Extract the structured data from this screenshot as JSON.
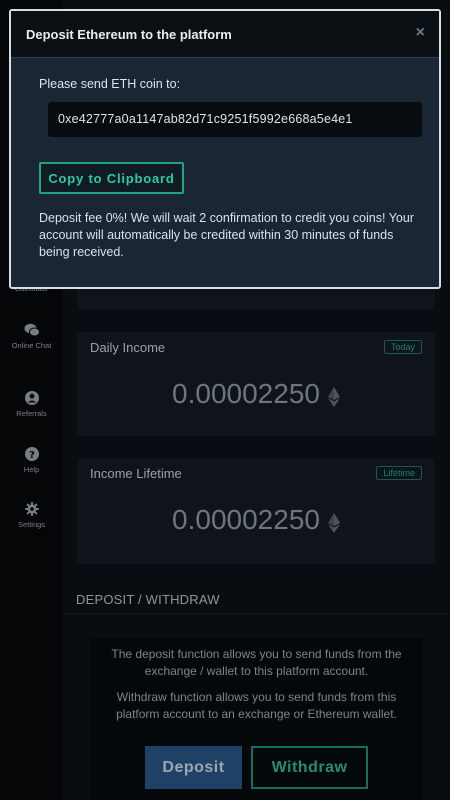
{
  "modal": {
    "title": "Deposit Ethereum to the platform",
    "close_symbol": "×",
    "send_label": "Please send ETH coin to:",
    "address": "0xe42777a0a1147ab82d71c9251f5992e668a5e4e1",
    "copy_button": "Copy to Clipboard",
    "fee_note": "Deposit fee 0%! We will wait 2 confirmation to credit you coins! Your account will automatically be credited within 30 minutes of funds being received."
  },
  "sidebar": {
    "items": [
      {
        "label": "Calculator",
        "icon": "calculator-icon"
      },
      {
        "label": "Online Chat",
        "icon": "chat-icon"
      },
      {
        "label": "Referrals",
        "icon": "user-icon"
      },
      {
        "label": "Help",
        "icon": "question-icon"
      },
      {
        "label": "Settings",
        "icon": "gear-icon"
      }
    ]
  },
  "cards": {
    "daily": {
      "title": "Daily Income",
      "badge": "Today",
      "value": "0.00002250"
    },
    "lifetime": {
      "title": "Income Lifetime",
      "badge": "Lifetime",
      "value": "0.00002250"
    }
  },
  "deposit_withdraw": {
    "heading": "DEPOSIT / WITHDRAW",
    "deposit_text": "The deposit function allows you to send funds from the exchange / wallet to this platform account.",
    "withdraw_text": "Withdraw function allows you to send funds from this platform account to an exchange or Ethereum wallet.",
    "deposit_button": "Deposit",
    "withdraw_button": "Withdraw"
  },
  "colors": {
    "accent_teal": "#27b39c",
    "deposit_blue": "#2b5a8c",
    "modal_bg": "#1a2633"
  }
}
